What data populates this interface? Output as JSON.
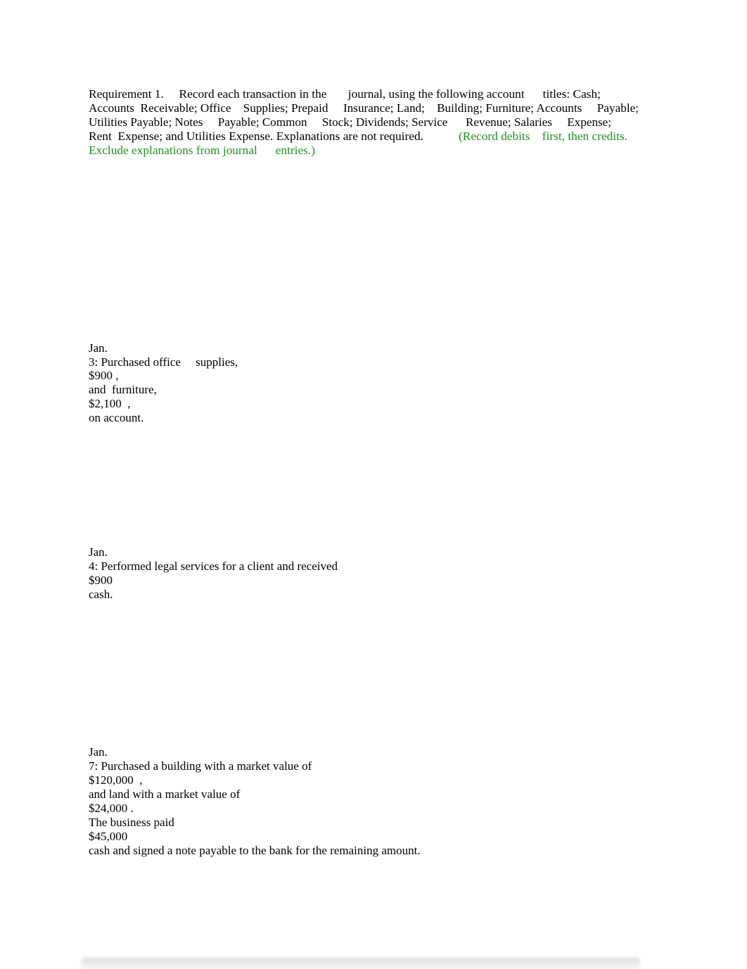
{
  "requirement": {
    "lines": [
      "Requirement 1.     Record each transaction in the       journal, using the following account      titles: Cash;",
      "Accounts  Receivable; Office    Supplies; Prepaid     Insurance; Land;    Building; Furniture; Accounts     Payable;",
      "Utilities Payable; Notes     Payable; Common     Stock; Dividends; Service      Revenue; Salaries     Expense;",
      "Rent  Expense; and Utilities Expense. Explanations are not required."
    ],
    "instruction_line_4": "(Record debits    first, then credits.",
    "instruction_line_5": "Exclude explanations from journal      entries.)"
  },
  "transactions": [
    {
      "lines": [
        "Jan.",
        "3: Purchased office     supplies,",
        "$900 ,",
        "and  furniture,",
        "$2,100  ,",
        "on account."
      ]
    },
    {
      "lines": [
        "Jan.",
        "4: Performed legal services for a client and received",
        "$900",
        "cash."
      ]
    },
    {
      "lines": [
        "Jan.",
        "7: Purchased a building with a market value of",
        "$120,000  ,",
        "and land with a market value of",
        "$24,000 .",
        "The business paid",
        "$45,000",
        "cash and signed a note payable to the bank for the remaining amount."
      ]
    }
  ],
  "colors": {
    "text": "#000000",
    "instruction": "#1f8f1f"
  }
}
